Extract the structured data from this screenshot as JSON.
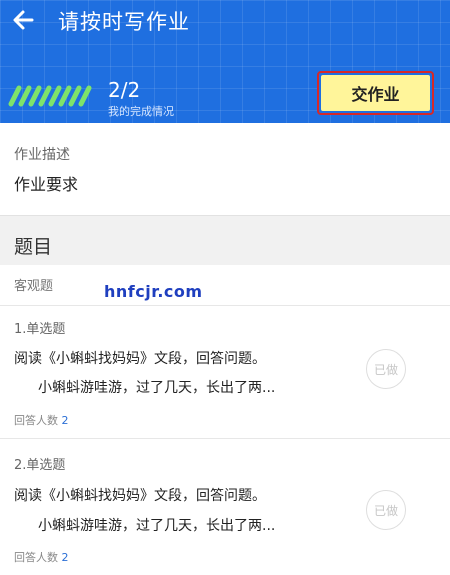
{
  "header": {
    "title": "请按时写作业",
    "progress_count": "2/2",
    "progress_label": "我的完成情况",
    "submit_label": "交作业",
    "accent_color": "#1f6fe0",
    "submit_color": "#fff59a"
  },
  "description": {
    "label": "作业描述",
    "value": "作业要求"
  },
  "section": {
    "title": "题目",
    "objective_label": "客观题"
  },
  "watermark": "hnfcjr.com",
  "questions": [
    {
      "type": "1.单选题",
      "text": "阅读《小蝌蚪找妈妈》文段，回答问题。",
      "excerpt": "小蝌蚪游哇游，过了几天，长出了两...",
      "answer_count_label": "回答人数",
      "answer_count": "2",
      "status": "已做"
    },
    {
      "type": "2.单选题",
      "text": "阅读《小蝌蚪找妈妈》文段，回答问题。",
      "excerpt": "小蝌蚪游哇游，过了几天，长出了两...",
      "answer_count_label": "回答人数",
      "answer_count": "2",
      "status": "已做"
    }
  ]
}
